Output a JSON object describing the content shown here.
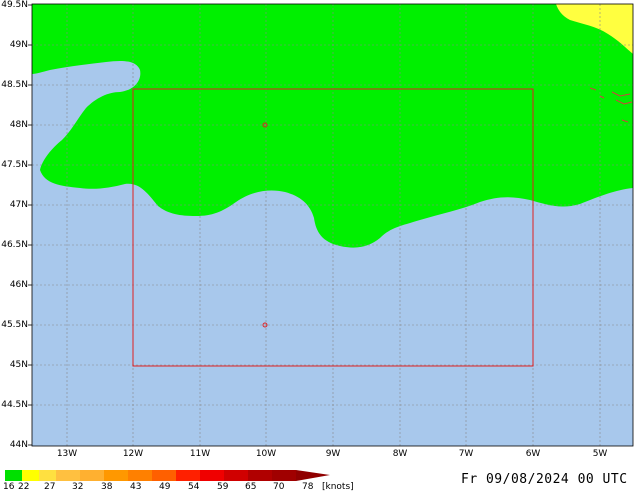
{
  "map": {
    "lat_labels": [
      "49.5N",
      "49N",
      "48.5N",
      "48N",
      "47.5N",
      "47N",
      "46.5N",
      "46N",
      "45.5N",
      "45N",
      "44.5N",
      "44N"
    ],
    "lon_labels": [
      "13W",
      "12W",
      "11W",
      "10W",
      "9W",
      "8W",
      "7W",
      "6W",
      "5W"
    ],
    "colors": {
      "sea": "#a8c8ec",
      "wind_16_22": "#00f000",
      "wind_22_27": "#ffff40",
      "box": "#e02020",
      "grid": "#888888"
    }
  },
  "legend": {
    "values": [
      "16",
      "22",
      "27",
      "32",
      "38",
      "43",
      "49",
      "54",
      "59",
      "65",
      "70",
      "78"
    ],
    "unit": "[knots]",
    "colors": [
      "#00e000",
      "#ffff00",
      "#ffe000",
      "#ffc000",
      "#ffa000",
      "#ff8000",
      "#ff6000",
      "#ff0000",
      "#e00000",
      "#c00000",
      "#a00000",
      "#800000"
    ]
  },
  "timestamp": "Fr 09/08/2024 00 UTC"
}
